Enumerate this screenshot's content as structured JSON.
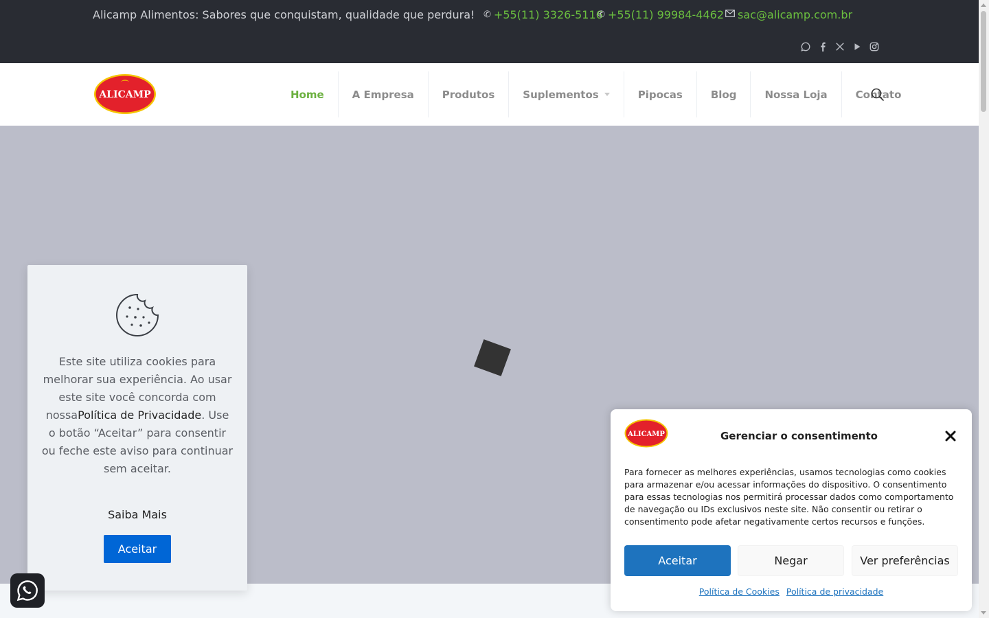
{
  "topbar": {
    "tagline": "Alicamp Alimentos: Sabores que conquistam, qualidade que perdura!",
    "phone1": "+55(11) 3326-5116",
    "phone2": "+55(11) 99984-4462",
    "email": "sac@alicamp.com.br",
    "social_icons": [
      "whatsapp-icon",
      "facebook-icon",
      "x-icon",
      "youtube-icon",
      "instagram-icon"
    ]
  },
  "header": {
    "logo_text": "ALICAMP",
    "nav": [
      {
        "label": "Home",
        "active": true
      },
      {
        "label": "A Empresa"
      },
      {
        "label": "Produtos"
      },
      {
        "label": "Suplementos",
        "has_dropdown": true
      },
      {
        "label": "Pipocas"
      },
      {
        "label": "Blog"
      },
      {
        "label": "Nossa Loja"
      },
      {
        "label": "Contato"
      }
    ]
  },
  "cookie_notice": {
    "text_before": "Este site utiliza cookies para melhorar sua experiência. Ao usar este site você concorda com nossa",
    "policy_link": "Política de Privacidade",
    "text_after": ". Use o botão “Aceitar” para consentir ou feche este aviso para continuar sem aceitar.",
    "more_label": "Saiba Mais",
    "accept_label": "Aceitar"
  },
  "consent": {
    "title": "Gerenciar o consentimento",
    "body": "Para fornecer as melhores experiências, usamos tecnologias como cookies para armazenar e/ou acessar informações do dispositivo. O consentimento para essas tecnologias nos permitirá processar dados como comportamento de navegação ou IDs exclusivos neste site. Não consentir ou retirar o consentimento pode afetar negativamente certos recursos e funções.",
    "accept_label": "Aceitar",
    "deny_label": "Negar",
    "prefs_label": "Ver preferências",
    "cookie_policy_link": "Política de Cookies",
    "privacy_policy_link": "Política de privacidade"
  },
  "colors": {
    "topbar_bg": "#292c33",
    "accent_green": "#6bb03f",
    "hero_bg": "#bbbdc9",
    "cookie_accept_blue": "#0066d6",
    "consent_blue": "#1e73be",
    "logo_red": "#e3212b",
    "logo_yellow": "#f5c400"
  }
}
